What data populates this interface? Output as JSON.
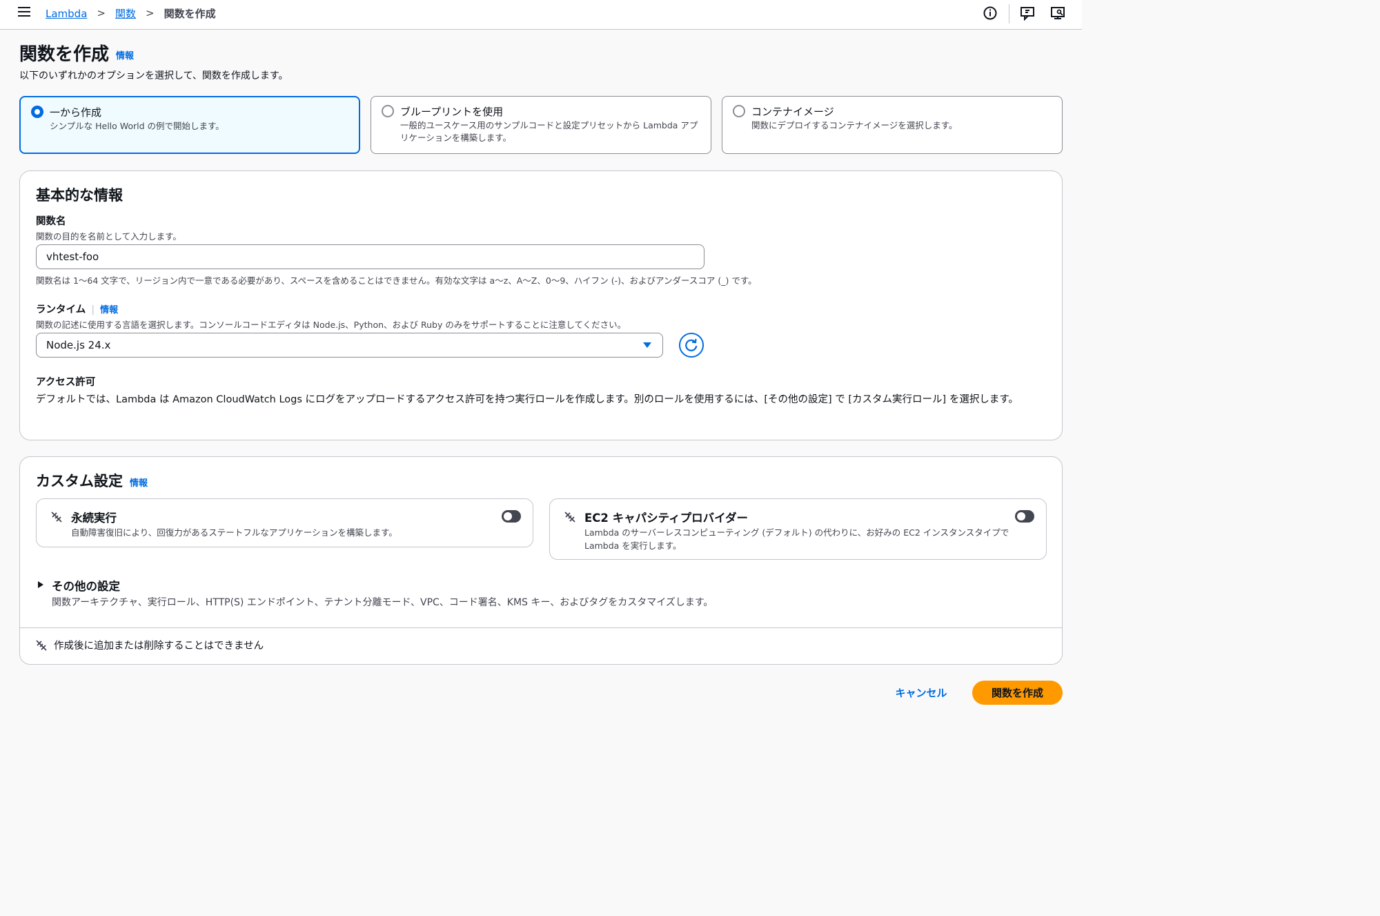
{
  "breadcrumb": {
    "items": [
      "Lambda",
      "関数"
    ],
    "current": "関数を作成"
  },
  "page": {
    "title": "関数を作成",
    "info": "情報",
    "subtitle": "以下のいずれかのオプションを選択して、関数を作成します。"
  },
  "options": [
    {
      "title": "一から作成",
      "desc": "シンプルな Hello World の例で開始します。",
      "selected": true
    },
    {
      "title": "ブループリントを使用",
      "desc": "一般的ユースケース用のサンプルコードと設定プリセットから Lambda アプリケーションを構築します。",
      "selected": false
    },
    {
      "title": "コンテナイメージ",
      "desc": "関数にデプロイするコンテナイメージを選択します。",
      "selected": false
    }
  ],
  "basic": {
    "title": "基本的な情報",
    "fn_name": {
      "label": "関数名",
      "desc": "関数の目的を名前として入力します。",
      "value": "vhtest-foo",
      "constraint": "関数名は 1〜64 文字で、リージョン内で一意である必要があり、スペースを含めることはできません。有効な文字は a〜z、A〜Z、0〜9、ハイフン (-)、およびアンダースコア (_) です。"
    },
    "runtime": {
      "label": "ランタイム",
      "info": "情報",
      "desc": "関数の記述に使用する言語を選択します。コンソールコードエディタは Node.js、Python、および Ruby のみをサポートすることに注意してください。",
      "value": "Node.js 24.x"
    },
    "access": {
      "label": "アクセス許可",
      "text": "デフォルトでは、Lambda は Amazon CloudWatch Logs にログをアップロードするアクセス許可を持つ実行ロールを作成します。別のロールを使用するには、[その他の設定] で [カスタム実行ロール] を選択します。"
    }
  },
  "custom": {
    "title": "カスタム設定",
    "info": "情報",
    "cards": [
      {
        "title": "永続実行",
        "desc": "自動障害復旧により、回復力があるステートフルなアプリケーションを構築します。",
        "enabled": false
      },
      {
        "title": "EC2 キャパシティプロバイダー",
        "desc": "Lambda のサーバーレスコンピューティング (デフォルト) の代わりに、お好みの EC2 インスタンスタイプで Lambda を実行します。",
        "enabled": false
      }
    ],
    "more": {
      "title": "その他の設定",
      "desc": "関数アーキテクチャ、実行ロール、HTTP(S) エンドポイント、テナント分離モード、VPC、コード署名、KMS キー、およびタグをカスタマイズします。"
    },
    "note": "作成後に追加または削除することはできません"
  },
  "actions": {
    "cancel": "キャンセル",
    "create": "関数を作成"
  },
  "colors": {
    "accent": "#006ce0",
    "primary_button": "#ff9900",
    "selected_bg": "#f0fbff"
  }
}
